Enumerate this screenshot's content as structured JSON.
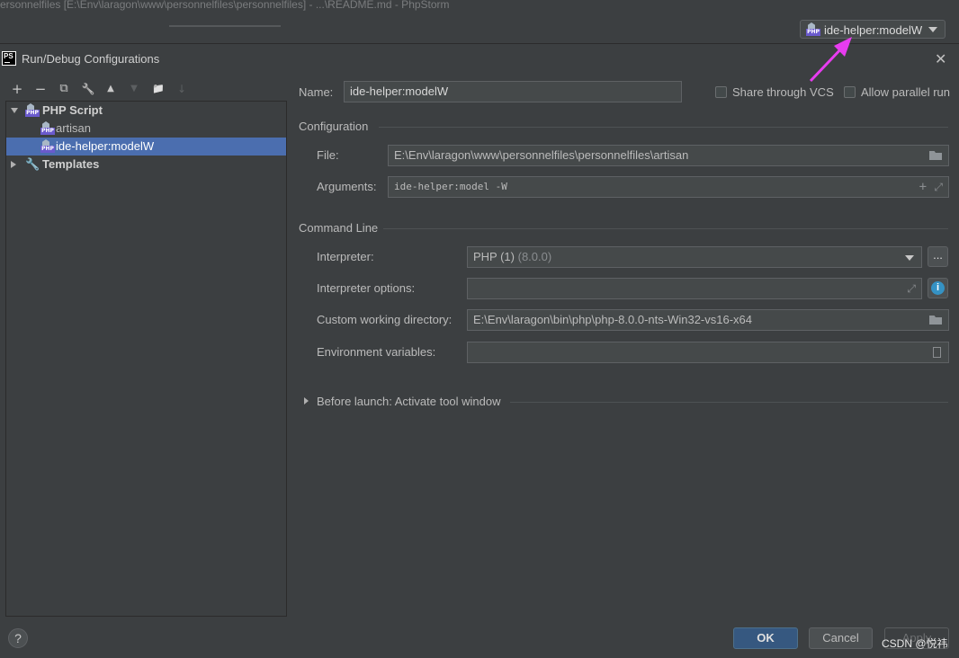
{
  "app": {
    "window_title": "ersonnelfiles [E:\\Env\\laragon\\www\\personnelfiles\\personnelfiles] - ...\\README.md - PhpStorm",
    "run_config_selector": "ide-helper:modelW"
  },
  "dialog": {
    "title": "Run/Debug Configurations",
    "logo_text": "PS"
  },
  "toolbar": {
    "add": "+",
    "remove": "−",
    "copy": "⧉",
    "edit": "🔧",
    "up": "▲",
    "down": "▼",
    "folder": "📁",
    "sort": "↓"
  },
  "tree": {
    "group_label": "PHP Script",
    "items": [
      {
        "label": "artisan"
      },
      {
        "label": "ide-helper:modelW"
      }
    ],
    "templates_label": "Templates"
  },
  "form": {
    "name_label": "Name:",
    "name_value": "ide-helper:modelW",
    "share_vcs_label": "Share through VCS",
    "allow_parallel_label": "Allow parallel run",
    "configuration_section": "Configuration",
    "file_label": "File:",
    "file_value": "E:\\Env\\laragon\\www\\personnelfiles\\personnelfiles\\artisan",
    "arguments_label": "Arguments:",
    "arguments_value": "ide-helper:model -W",
    "command_line_section": "Command Line",
    "interpreter_label": "Interpreter:",
    "interpreter_value": "PHP (1)",
    "interpreter_version": "(8.0.0)",
    "interpreter_options_label": "Interpreter options:",
    "interpreter_options_value": "",
    "cwd_label": "Custom working directory:",
    "cwd_value": "E:\\Env\\laragon\\bin\\php\\php-8.0.0-nts-Win32-vs16-x64",
    "env_label": "Environment variables:",
    "env_value": "",
    "before_launch_label": "Before launch: Activate tool window",
    "more_button": "..."
  },
  "buttons": {
    "ok": "OK",
    "cancel": "Cancel",
    "apply": "Apply",
    "help": "?"
  },
  "watermark": "CSDN @悦祎",
  "colors": {
    "background": "#3c3f41",
    "selection": "#4b6eaf",
    "ok_button": "#365880",
    "annotation_arrow": "#e83cf0"
  }
}
